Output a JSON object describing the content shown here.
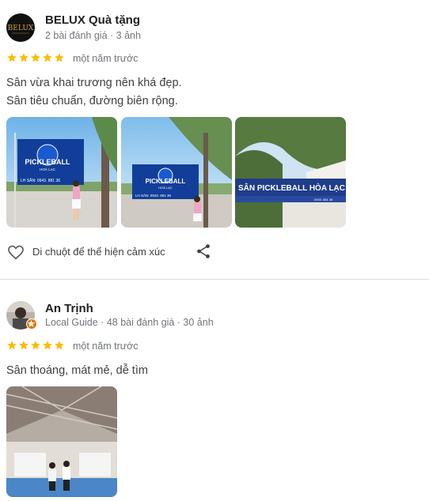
{
  "colors": {
    "star": "#fbbc04",
    "text": "#3c4043",
    "secondary": "#70757a",
    "divider": "#dadce0"
  },
  "reviews": [
    {
      "author": "BELUX Quà tặng",
      "meta": "2 bài đánh giá · 3 ảnh",
      "avatar_text": "BELUX",
      "rating": 5,
      "time": "một năm trước",
      "text_lines": [
        "Sân vừa khai trương nên khá đẹp.",
        "Sân tiêu chuẩn, đường biên rộng."
      ],
      "photos": [
        {
          "banner_title": "PICKLEBALL",
          "banner_sub": "HOÀ LẠC",
          "banner_phone": "LH SÂN: 0943. 881 36"
        },
        {
          "banner_title": "PICKLEBALL",
          "banner_sub": "HOÀ LẠC",
          "banner_phone": "LH SÂN: 0943. 881 36"
        },
        {
          "sign_text": "SÂN PICKLEBALL HÒA LẠC",
          "sign_phone": "0943. 881 36"
        }
      ],
      "react_label": "Di chuột để thể hiện cảm xúc",
      "icons": {
        "react": "heart-icon",
        "share": "share-icon"
      }
    },
    {
      "author": "An Trịnh",
      "meta": "Local Guide · 48 bài đánh giá · 30 ảnh",
      "rating": 5,
      "time": "một năm trước",
      "text_lines": [
        "Sân thoáng, mát mẻ, dễ tìm"
      ],
      "icons": {
        "badge": "local-guide-badge-icon"
      }
    }
  ]
}
